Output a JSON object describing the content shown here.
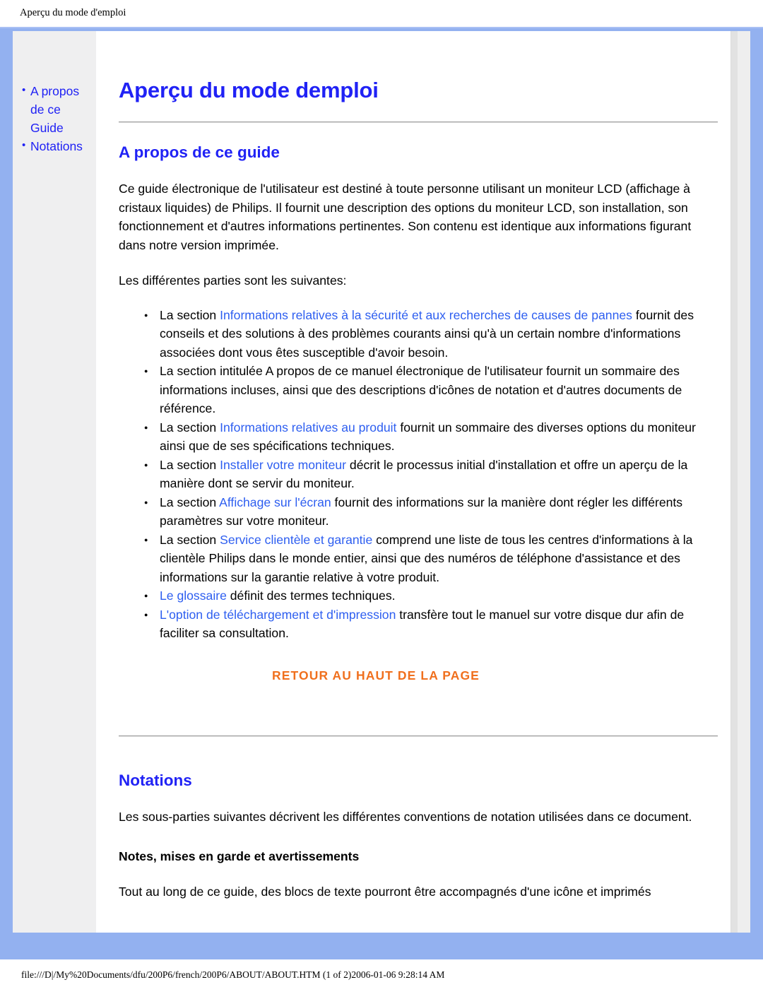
{
  "print_header": {
    "title": "Aperçu du mode d'emploi"
  },
  "print_footer": {
    "path": "file:///D|/My%20Documents/dfu/200P6/french/200P6/ABOUT/ABOUT.HTM (1 of 2)2006-01-06 9:28:14 AM"
  },
  "sidebar": {
    "items": [
      {
        "label": "A propos de ce Guide"
      },
      {
        "label": "Notations"
      }
    ]
  },
  "main": {
    "page_title": "Aperçu du mode demploi",
    "section_about": {
      "heading": "A propos de ce guide",
      "intro": "Ce guide électronique de l'utilisateur est destiné à toute personne utilisant un moniteur LCD (affichage à cristaux liquides) de Philips. Il fournit une description des options du moniteur LCD, son installation, son fonctionnement et d'autres informations pertinentes. Son contenu est identique aux informations figurant dans notre version imprimée.",
      "lead_in": "Les différentes parties sont les suivantes:",
      "items": [
        {
          "prefix": "La section ",
          "link": "Informations relatives à la sécurité et aux recherches de causes de pannes",
          "suffix": " fournit des conseils et des solutions à des problèmes courants ainsi qu'à un certain nombre d'informations associées dont vous êtes susceptible d'avoir besoin."
        },
        {
          "prefix": "La section intitulée A propos de ce manuel électronique de l'utilisateur fournit un sommaire des informations incluses, ainsi que des descriptions d'icônes de notation et d'autres documents de référence.",
          "link": "",
          "suffix": ""
        },
        {
          "prefix": "La section ",
          "link": "Informations relatives au produit",
          "suffix": " fournit un sommaire des diverses options du moniteur ainsi que de ses spécifications techniques."
        },
        {
          "prefix": "La section ",
          "link": "Installer votre moniteur",
          "suffix": " décrit le processus initial d'installation et offre un aperçu de la manière dont se servir du moniteur."
        },
        {
          "prefix": "La section ",
          "link": "Affichage sur l'écran",
          "suffix": " fournit des informations sur la manière dont régler les différents paramètres sur votre moniteur."
        },
        {
          "prefix": "La section ",
          "link": "Service clientèle et garantie",
          "suffix": " comprend une liste de tous les centres d'informations à la clientèle Philips dans le monde entier, ainsi que des numéros de téléphone d'assistance et des informations sur la garantie relative à votre produit."
        },
        {
          "prefix": "",
          "link": "Le glossaire",
          "suffix": " définit des termes techniques."
        },
        {
          "prefix": "",
          "link": "L'option de téléchargement et d'impression",
          "suffix": " transfère tout le manuel sur votre disque dur afin de faciliter sa consultation."
        }
      ],
      "back_to_top": "RETOUR AU HAUT DE LA PAGE"
    },
    "section_notations": {
      "heading": "Notations",
      "intro": "Les sous-parties suivantes décrivent les différentes conventions de notation utilisées dans ce document.",
      "sub_heading": "Notes, mises en garde et avertissements",
      "body": "Tout au long de ce guide, des blocs de texte pourront être accompagnés d'une icône et imprimés"
    }
  },
  "colors": {
    "frame_blue": "#93b1f0",
    "heading_blue": "#2022f5",
    "link_blue": "#2d5ef0",
    "accent_orange": "#f0701e",
    "sidebar_gray": "#efeff0"
  }
}
